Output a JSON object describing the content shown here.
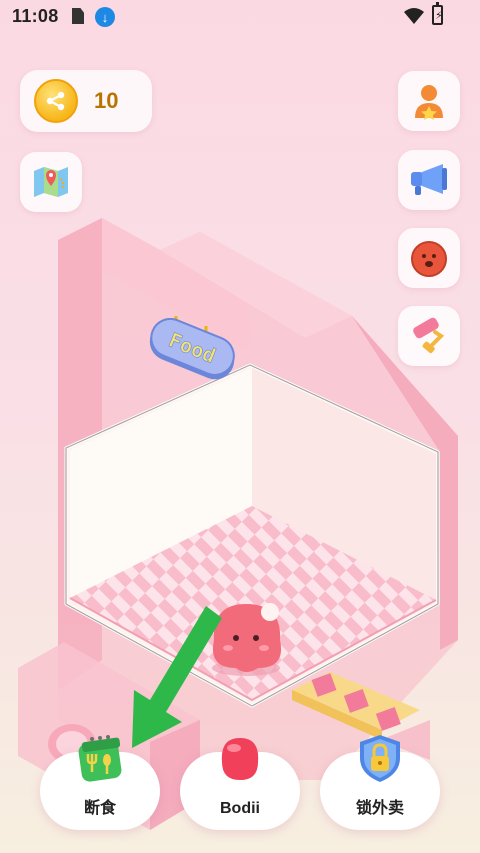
{
  "status_bar": {
    "time": "11:08"
  },
  "coins": {
    "count": "10"
  },
  "sign": {
    "text": "Food"
  },
  "bottom_nav": [
    {
      "label": "断食"
    },
    {
      "label": "Bodii"
    },
    {
      "label": "锁外卖"
    }
  ],
  "colors": {
    "accent_pink": "#f7a9ba",
    "coin": "#f7b619",
    "arrow": "#2fb84a"
  }
}
